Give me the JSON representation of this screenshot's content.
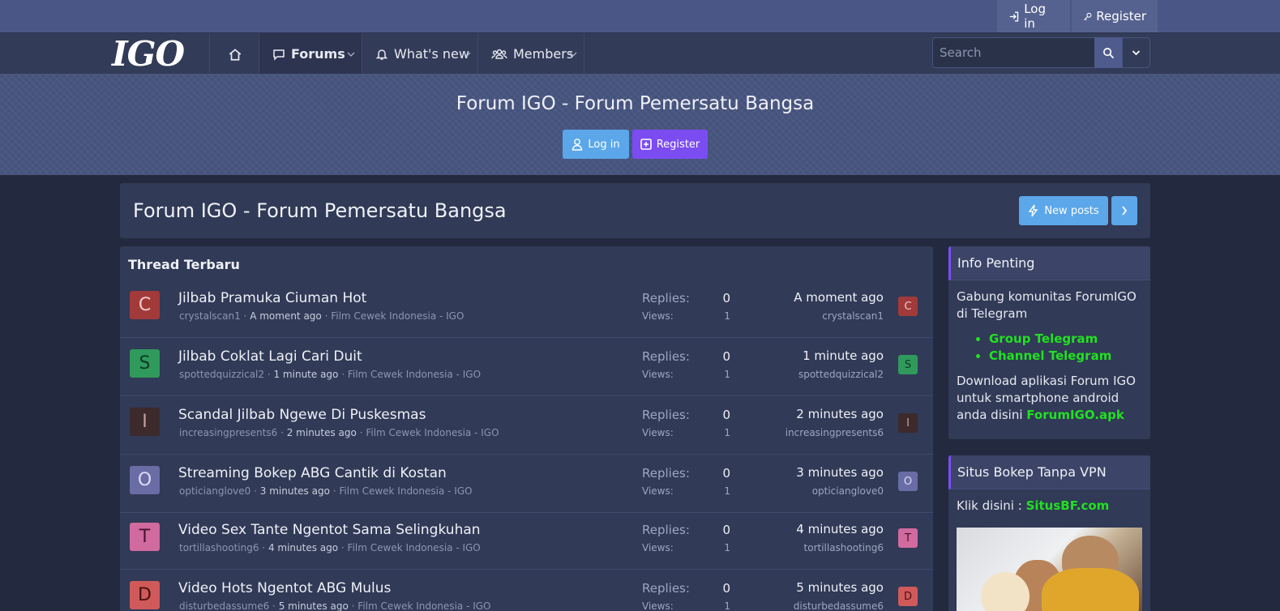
{
  "topbar": {
    "login_label": "Log in",
    "register_label": "Register"
  },
  "nav": {
    "logo": "IGO",
    "tabs": [
      {
        "label": "Forums",
        "icon": "comment-icon",
        "active": true
      },
      {
        "label": "What's new",
        "icon": "bell-icon",
        "active": false
      },
      {
        "label": "Members",
        "icon": "users-icon",
        "active": false
      }
    ],
    "search_placeholder": "Search"
  },
  "banner": {
    "title": "Forum IGO - Forum Pemersatu Bangsa",
    "login_label": "Log in",
    "register_label": "Register"
  },
  "page": {
    "title": "Forum IGO - Forum Pemersatu Bangsa",
    "new_posts_label": "New posts"
  },
  "threads": {
    "heading": "Thread Terbaru",
    "replies_label": "Replies:",
    "views_label": "Views:",
    "items": [
      {
        "letter": "C",
        "avatar_bg": "#a33a3a",
        "avatar_fg": "#f0caca",
        "title": "Jilbab Pramuka Ciuman Hot",
        "author": "crystalscan1",
        "time": "A moment ago",
        "forum": "Film Cewek Indonesia - IGO",
        "replies": "0",
        "views": "1",
        "last_time": "A moment ago",
        "last_user": "crystalscan1"
      },
      {
        "letter": "S",
        "avatar_bg": "#2f9a5c",
        "avatar_fg": "#0d3a21",
        "title": "Jilbab Coklat Lagi Cari Duit",
        "author": "spottedquizzical2",
        "time": "1 minute ago",
        "forum": "Film Cewek Indonesia - IGO",
        "replies": "0",
        "views": "1",
        "last_time": "1 minute ago",
        "last_user": "spottedquizzical2"
      },
      {
        "letter": "I",
        "avatar_bg": "#3c2a2c",
        "avatar_fg": "#c7a3a0",
        "title": "Scandal Jilbab Ngewe Di Puskesmas",
        "author": "increasingpresents6",
        "time": "2 minutes ago",
        "forum": "Film Cewek Indonesia - IGO",
        "replies": "0",
        "views": "1",
        "last_time": "2 minutes ago",
        "last_user": "increasingpresents6"
      },
      {
        "letter": "O",
        "avatar_bg": "#6a6ca6",
        "avatar_fg": "#dcdcf2",
        "title": "Streaming Bokep ABG Cantik di Kostan",
        "author": "opticianglove0",
        "time": "3 minutes ago",
        "forum": "Film Cewek Indonesia - IGO",
        "replies": "0",
        "views": "1",
        "last_time": "3 minutes ago",
        "last_user": "opticianglove0"
      },
      {
        "letter": "T",
        "avatar_bg": "#d16a9e",
        "avatar_fg": "#4a1230",
        "title": "Video Sex Tante Ngentot Sama Selingkuhan",
        "author": "tortillashooting6",
        "time": "4 minutes ago",
        "forum": "Film Cewek Indonesia - IGO",
        "replies": "0",
        "views": "1",
        "last_time": "4 minutes ago",
        "last_user": "tortillashooting6"
      },
      {
        "letter": "D",
        "avatar_bg": "#d05a5a",
        "avatar_fg": "#4a1010",
        "title": "Video Hots Ngentot ABG Mulus",
        "author": "disturbedassume6",
        "time": "5 minutes ago",
        "forum": "Film Cewek Indonesia - IGO",
        "replies": "0",
        "views": "1",
        "last_time": "5 minutes ago",
        "last_user": "disturbedassume6"
      }
    ]
  },
  "sidebar": {
    "info": {
      "title": "Info Penting",
      "intro": "Gabung komunitas ForumIGO di Telegram",
      "links": [
        "Group Telegram",
        "Channel Telegram"
      ],
      "download_text": "Download aplikasi Forum IGO untuk smartphone android anda disini ",
      "download_link": "ForumIGO.apk"
    },
    "vpn": {
      "title": "Situs Bokep Tanpa VPN",
      "text": "Klik disini : ",
      "link": "SitusBF.com"
    }
  },
  "colors": {
    "accent": "#5ba7ea",
    "register": "#7b4cf2",
    "link_green": "#22e022"
  }
}
